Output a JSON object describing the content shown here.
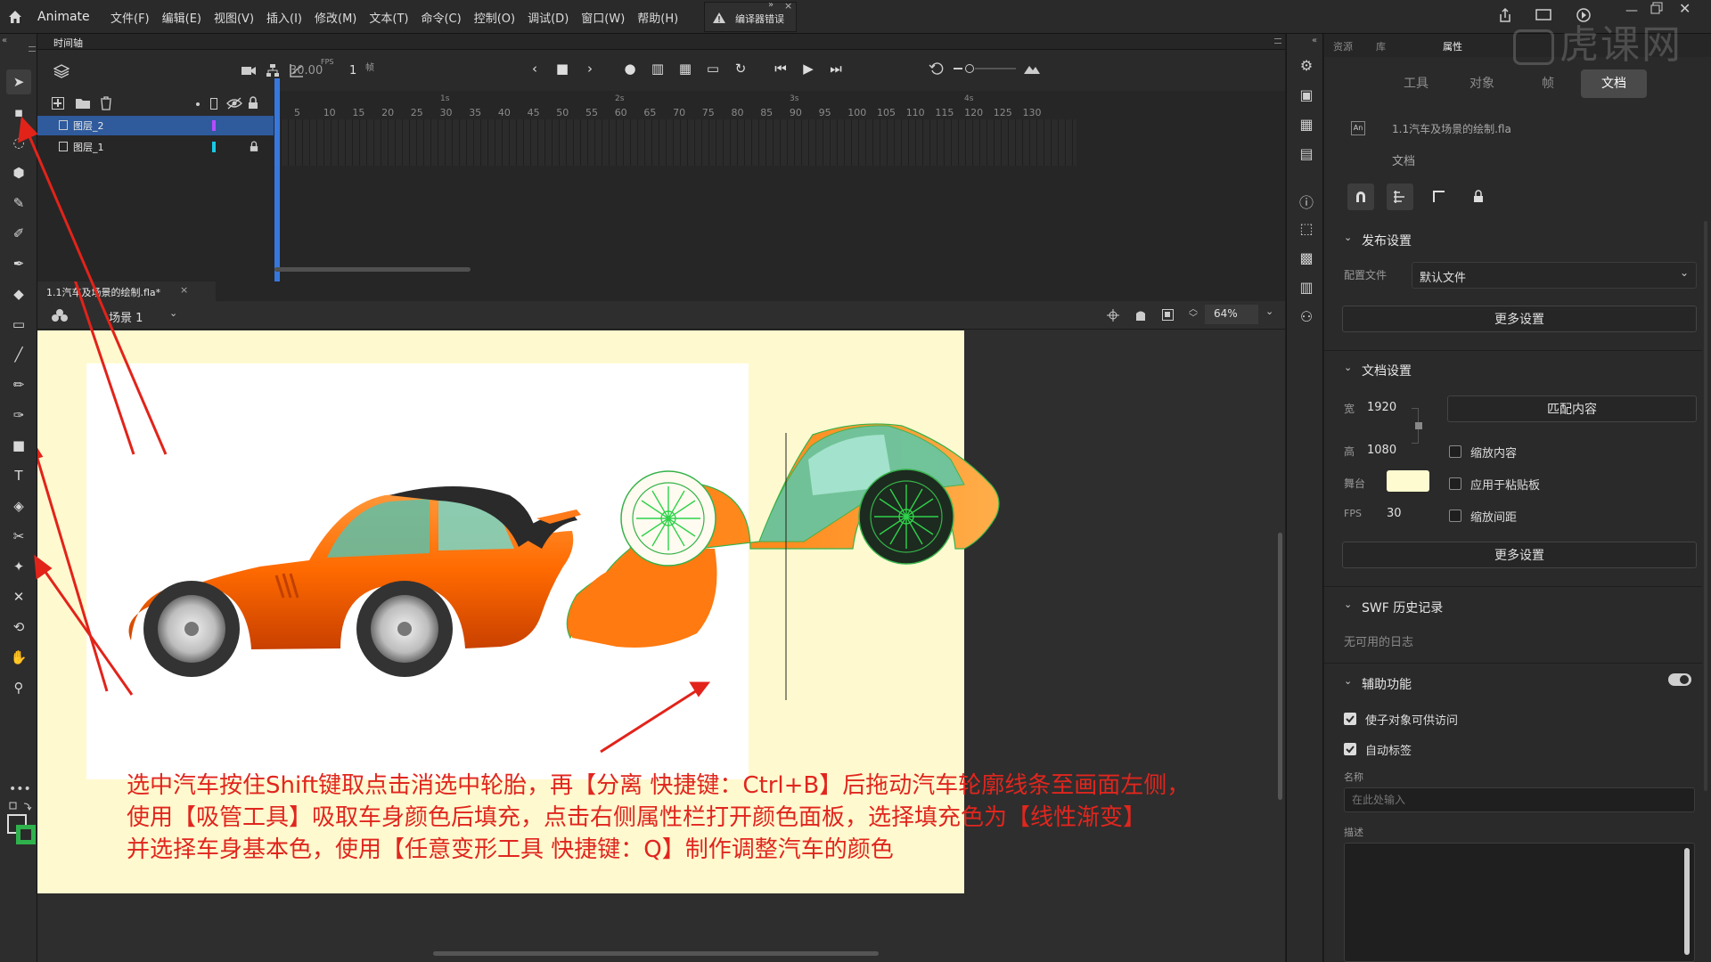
{
  "app": {
    "name": "Animate",
    "error_label": "编译器错误"
  },
  "menu": [
    "文件(F)",
    "编辑(E)",
    "视图(V)",
    "插入(I)",
    "修改(M)",
    "文本(T)",
    "命令(C)",
    "控制(O)",
    "调试(D)",
    "窗口(W)",
    "帮助(H)"
  ],
  "timeline": {
    "panel_title": "时间轴",
    "fps": "30.00",
    "fps_unit": "FPS",
    "current_frame": "1",
    "frame_unit": "帧",
    "layers": [
      {
        "name": "图层_2",
        "color": "#b44cff",
        "selected": true,
        "locked": false
      },
      {
        "name": "图层_1",
        "color": "#19c9e6",
        "selected": false,
        "locked": true
      }
    ],
    "second_labels": [
      "1s",
      "2s",
      "3s",
      "4s"
    ],
    "frame_ticks": [
      "5",
      "10",
      "15",
      "20",
      "25",
      "30",
      "35",
      "40",
      "45",
      "50",
      "55",
      "60",
      "65",
      "70",
      "75",
      "80",
      "85",
      "90",
      "95",
      "100",
      "105",
      "110",
      "115",
      "120",
      "125",
      "130"
    ]
  },
  "document_tab": {
    "name": "1.1汽车及场景的绘制.fla*",
    "close": "×"
  },
  "scene": {
    "name": "场景 1",
    "zoom": "64%"
  },
  "stage": {
    "background_color": "#fffbd0",
    "caption_lines": [
      "选中汽车按住Shift键取点击消选中轮胎，再【分离 快捷键：Ctrl+B】后拖动汽车轮廓线条至画面左侧，",
      "使用【吸管工具】吸取车身颜色后填充，点击右侧属性栏打开颜色面板，选择填充色为【线性渐变】",
      "并选择车身基本色，使用【任意变形工具 快捷键：Q】制作调整汽车的颜色"
    ]
  },
  "properties": {
    "top_tabs": [
      "资源",
      "库",
      "属性"
    ],
    "active_top_tab": "属性",
    "sub_tabs": [
      "工具",
      "对象",
      "帧",
      "文档"
    ],
    "active_sub_tab": "文档",
    "file_name": "1.1汽车及场景的绘制.fla",
    "file_type": "文档",
    "publish": {
      "title": "发布设置",
      "profile_label": "配置文件",
      "profile_value": "默认文件",
      "more_settings": "更多设置"
    },
    "doc_settings": {
      "title": "文档设置",
      "width_label": "宽",
      "width": "1920",
      "height_label": "高",
      "height": "1080",
      "match_content": "匹配内容",
      "scale_content": "缩放内容",
      "stage_label": "舞台",
      "stage_color": "#fffbd0",
      "apply_paste": "应用于粘贴板",
      "fps_label": "FPS",
      "fps": "30",
      "scale_spacing": "缩放间距",
      "more_settings": "更多设置"
    },
    "swf_history": {
      "title": "SWF 历史记录",
      "empty": "无可用的日志"
    },
    "accessibility": {
      "title": "辅助功能",
      "make_accessible": "使子对象可供访问",
      "auto_label": "自动标签",
      "name_label": "名称",
      "name_placeholder": "在此处输入",
      "desc_label": "描述"
    }
  },
  "watermark": "虎课网"
}
